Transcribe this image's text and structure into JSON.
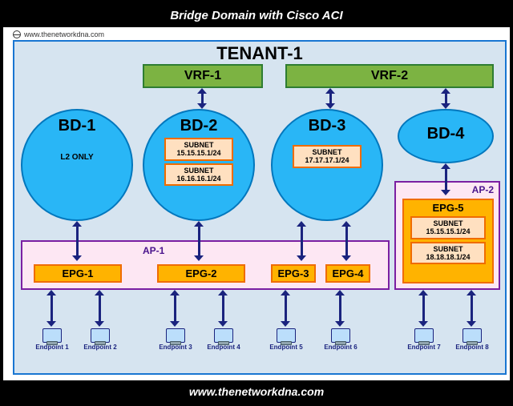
{
  "title": "Bridge Domain with Cisco ACI",
  "site_url": "www.thenetworkdna.com",
  "tenant": "TENANT-1",
  "vrfs": {
    "vrf1": "VRF-1",
    "vrf2": "VRF-2"
  },
  "bds": {
    "bd1": {
      "name": "BD-1",
      "note": "L2 ONLY"
    },
    "bd2": {
      "name": "BD-2",
      "subnets": [
        "SUBNET\n15.15.15.1/24",
        "SUBNET\n16.16.16.1/24"
      ]
    },
    "bd3": {
      "name": "BD-3",
      "subnets": [
        "SUBNET\n17.17.17.1/24"
      ]
    },
    "bd4": {
      "name": "BD-4"
    }
  },
  "aps": {
    "ap1": "AP-1",
    "ap2": "AP-2"
  },
  "epgs": {
    "epg1": "EPG-1",
    "epg2": "EPG-2",
    "epg3": "EPG-3",
    "epg4": "EPG-4",
    "epg5": {
      "name": "EPG-5",
      "subnets": [
        "SUBNET\n15.15.15.1/24",
        "SUBNET\n18.18.18.1/24"
      ]
    }
  },
  "endpoints": [
    "Endpoint 1",
    "Endpoint 2",
    "Endpoint 3",
    "Endpoint 4",
    "Endpoint 5",
    "Endpoint 6",
    "Endpoint 7",
    "Endpoint 8"
  ],
  "footer": "www.thenetworkdna.com",
  "colors": {
    "tenant_border": "#1976d2",
    "tenant_fill": "#d6e4f0",
    "vrf_fill": "#7cb342",
    "bd_fill": "#29b6f6",
    "subnet_fill": "#ffe0c0",
    "ap_fill": "#fde7f3",
    "epg_fill": "#ffb300",
    "arrow": "#1a237e"
  }
}
